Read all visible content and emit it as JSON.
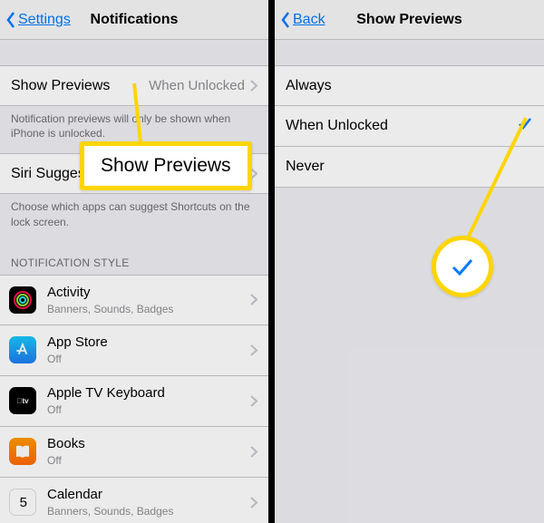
{
  "left": {
    "nav": {
      "back": "Settings",
      "title": "Notifications"
    },
    "show_previews": {
      "label": "Show Previews",
      "value": "When Unlocked"
    },
    "show_previews_footer": "Notification previews will only be shown when iPhone is unlocked.",
    "siri": {
      "label": "Siri Suggestions"
    },
    "siri_footer": "Choose which apps can suggest Shortcuts on the lock screen.",
    "style_header": "NOTIFICATION STYLE",
    "apps": [
      {
        "name": "Activity",
        "sub": "Banners, Sounds, Badges",
        "icon": "activity"
      },
      {
        "name": "App Store",
        "sub": "Off",
        "icon": "appstore"
      },
      {
        "name": "Apple TV Keyboard",
        "sub": "Off",
        "icon": "appletv"
      },
      {
        "name": "Books",
        "sub": "Off",
        "icon": "books"
      },
      {
        "name": "Calendar",
        "sub": "Banners, Sounds, Badges",
        "icon": "calendar"
      }
    ]
  },
  "right": {
    "nav": {
      "back": "Back",
      "title": "Show Previews"
    },
    "options": [
      {
        "label": "Always",
        "checked": false
      },
      {
        "label": "When Unlocked",
        "checked": true
      },
      {
        "label": "Never",
        "checked": false
      }
    ]
  },
  "callout_label": "Show Previews",
  "calendar_day": "5"
}
